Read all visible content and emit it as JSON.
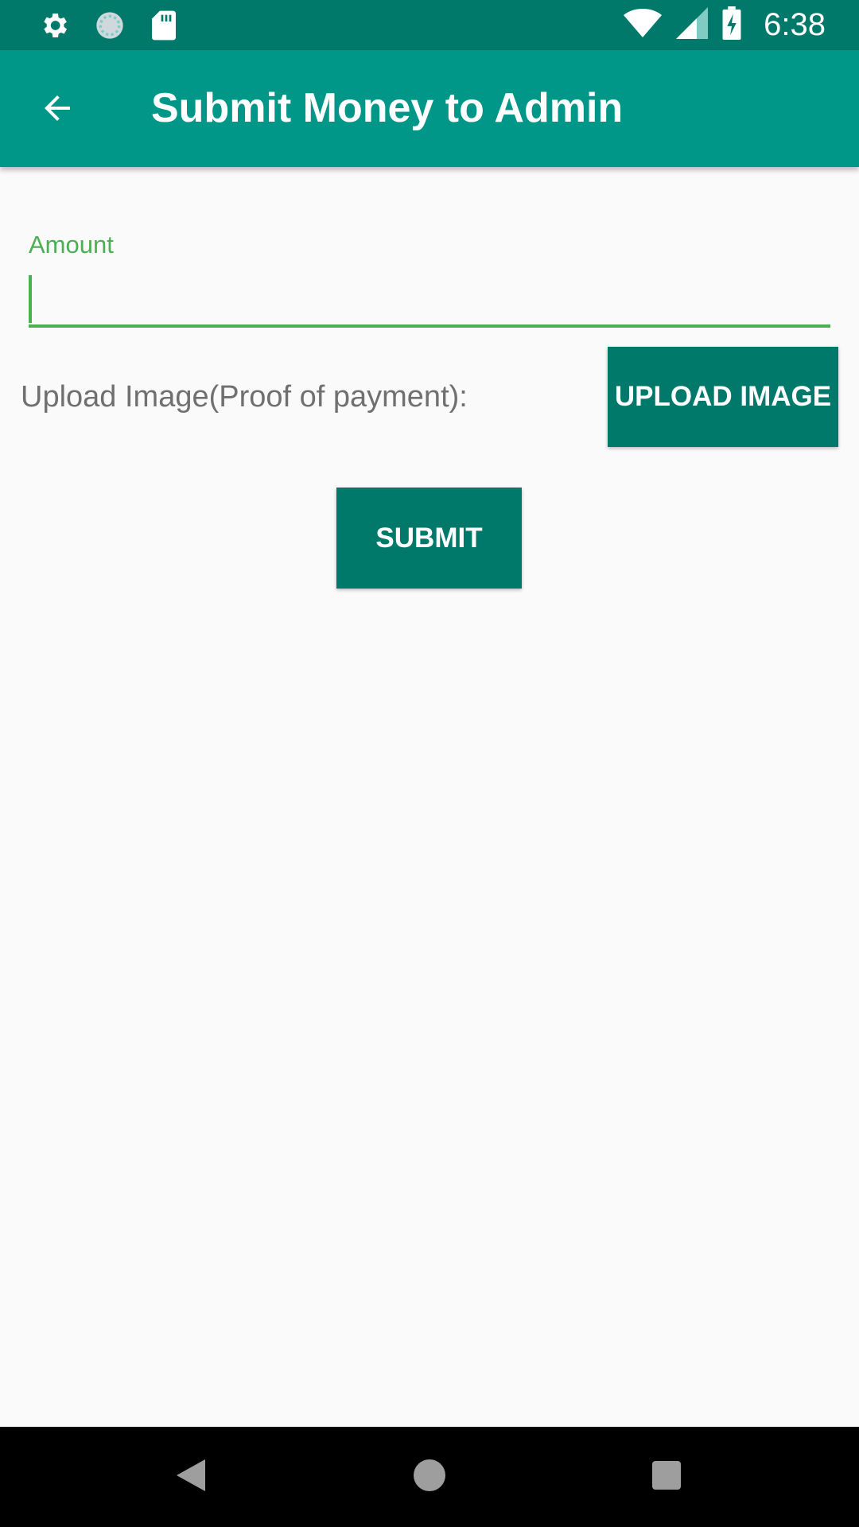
{
  "status_bar": {
    "time": "6:38",
    "left_icons": [
      "settings-icon",
      "sync-icon",
      "sd-card-icon"
    ],
    "right_icons": [
      "wifi-icon",
      "signal-icon",
      "battery-charging-icon"
    ],
    "background": "#00796b"
  },
  "app_bar": {
    "title": "Submit Money to Admin",
    "back_icon": "arrow-back-icon",
    "background": "#009688"
  },
  "form": {
    "amount": {
      "label": "Amount",
      "value": "",
      "accent_color": "#4caf50"
    },
    "upload": {
      "label": "Upload Image(Proof of payment):",
      "button_label": "UPLOAD IMAGE"
    },
    "submit_label": "SUBMIT",
    "button_color": "#00796b"
  },
  "nav_bar": {
    "buttons": [
      "back-triangle-icon",
      "home-circle-icon",
      "recents-square-icon"
    ]
  }
}
